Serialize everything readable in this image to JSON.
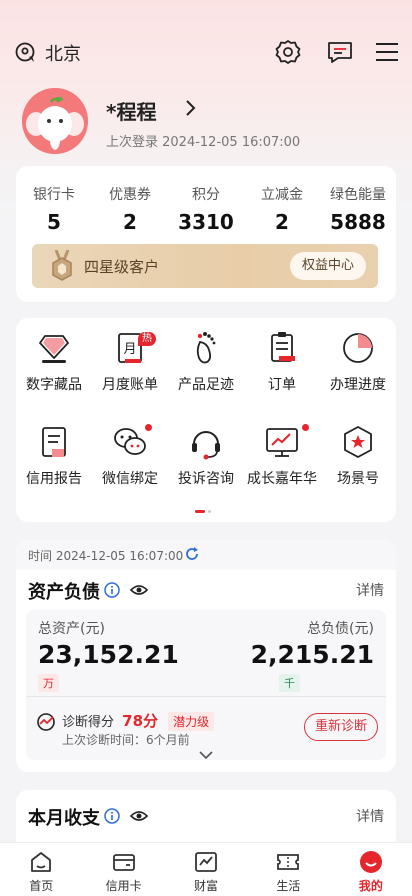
{
  "header": {
    "location": "北京",
    "icons": [
      "location-icon",
      "settings-icon",
      "message-icon",
      "menu-icon"
    ]
  },
  "profile": {
    "name": "*程程",
    "last_login": "上次登录 2024-12-05 16:07:00"
  },
  "stats": [
    {
      "label": "银行卡",
      "value": "5"
    },
    {
      "label": "优惠券",
      "value": "2"
    },
    {
      "label": "积分",
      "value": "3310"
    },
    {
      "label": "立减金",
      "value": "2"
    },
    {
      "label": "绿色能量",
      "value": "5888"
    }
  ],
  "vip": {
    "level": "四星级客户",
    "button": "权益中心"
  },
  "shortcuts": [
    {
      "label": "数字藏品",
      "icon": "diamond-icon"
    },
    {
      "label": "月度账单",
      "icon": "bill-icon",
      "badge": "热"
    },
    {
      "label": "产品足迹",
      "icon": "footprint-icon"
    },
    {
      "label": "订单",
      "icon": "order-icon"
    },
    {
      "label": "办理进度",
      "icon": "progress-icon"
    },
    {
      "label": "信用报告",
      "icon": "report-icon"
    },
    {
      "label": "微信绑定",
      "icon": "wechat-icon",
      "dot": true
    },
    {
      "label": "投诉咨询",
      "icon": "headset-icon"
    },
    {
      "label": "成长嘉年华",
      "icon": "growth-icon",
      "dot": true
    },
    {
      "label": "场景号",
      "icon": "scene-icon"
    }
  ],
  "assets": {
    "time": "时间 2024-12-05 16:07:00",
    "title": "资产负债",
    "detail": "详情",
    "total_assets_label": "总资产(元)",
    "total_assets": "23,152.21",
    "total_assets_tag": "万",
    "total_debt_label": "总负债(元)",
    "total_debt": "2,215.21",
    "total_debt_tag": "千",
    "diag_label": "诊断得分",
    "diag_score": "78分",
    "diag_level": "潜力级",
    "diag_time": "上次诊断时间：6个月前",
    "diag_button": "重新诊断"
  },
  "monthly": {
    "title": "本月收支",
    "detail": "详情"
  },
  "tabs": [
    {
      "label": "首页",
      "icon": "home-icon"
    },
    {
      "label": "信用卡",
      "icon": "credit-card-icon"
    },
    {
      "label": "财富",
      "icon": "wealth-icon"
    },
    {
      "label": "生活",
      "icon": "life-icon"
    },
    {
      "label": "我的",
      "icon": "mine-icon",
      "active": true
    }
  ],
  "colors": {
    "brand_red": "#e5262d",
    "vip_gold": "#e8cda8",
    "debt_tag_green": "#2e8b57"
  }
}
